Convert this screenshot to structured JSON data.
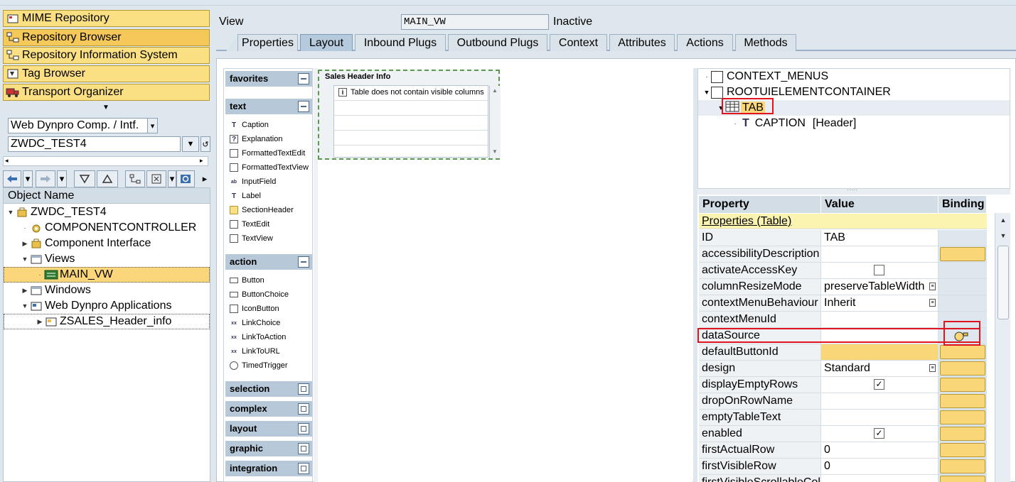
{
  "nav": {
    "buttons": [
      "MIME Repository",
      "Repository Browser",
      "Repository Information System",
      "Tag Browser",
      "Transport Organizer"
    ],
    "object_type": "Web Dynpro Comp. / Intf.",
    "object_name": "ZWDC_TEST4"
  },
  "object_tree": {
    "header": "Object Name",
    "rows": [
      "ZWDC_TEST4",
      "COMPONENTCONTROLLER",
      "Component Interface",
      "Views",
      "MAIN_VW",
      "Windows",
      "Web Dynpro Applications",
      "ZSALES_Header_info"
    ]
  },
  "view": {
    "label": "View",
    "name": "MAIN_VW",
    "status": "Inactive"
  },
  "tabs": [
    "Properties",
    "Layout",
    "Inbound Plugs",
    "Outbound Plugs",
    "Context",
    "Attributes",
    "Actions",
    "Methods"
  ],
  "palette": {
    "favorites": "favorites",
    "text": "text",
    "text_items": [
      "Caption",
      "Explanation",
      "FormattedTextEdit",
      "FormattedTextView",
      "InputField",
      "Label",
      "SectionHeader",
      "TextEdit",
      "TextView"
    ],
    "action": "action",
    "action_items": [
      "Button",
      "ButtonChoice",
      "IconButton",
      "LinkChoice",
      "LinkToAction",
      "LinkToURL",
      "TimedTrigger"
    ],
    "collapsed": [
      "selection",
      "complex",
      "layout",
      "graphic",
      "integration"
    ]
  },
  "table_preview": {
    "title": "Sales Header Info",
    "message": "Table does not contain visible columns"
  },
  "ui_tree": {
    "rows": [
      "CONTEXT_MENUS",
      "ROOTUIELEMENTCONTAINER",
      "TAB",
      "CAPTION",
      "[Header]"
    ]
  },
  "properties": {
    "headers": [
      "Property",
      "Value",
      "Binding"
    ],
    "section": "Properties (Table)",
    "rows": [
      {
        "name": "ID",
        "value": "TAB",
        "kind": "text",
        "bind": false
      },
      {
        "name": "accessibilityDescription",
        "value": "",
        "kind": "text",
        "bind": true
      },
      {
        "name": "activateAccessKey",
        "value": "",
        "kind": "checkbox",
        "checked": false,
        "bind": false
      },
      {
        "name": "columnResizeMode",
        "value": "preserveTableWidth",
        "kind": "dropdown",
        "bind": false
      },
      {
        "name": "contextMenuBehaviour",
        "value": "Inherit",
        "kind": "dropdown",
        "bind": false
      },
      {
        "name": "contextMenuId",
        "value": "",
        "kind": "text",
        "bind": false
      },
      {
        "name": "dataSource",
        "value": "",
        "kind": "text",
        "bind": "icon"
      },
      {
        "name": "defaultButtonId",
        "value": "",
        "kind": "yellow",
        "bind": true
      },
      {
        "name": "design",
        "value": "Standard",
        "kind": "dropdown",
        "bind": true
      },
      {
        "name": "displayEmptyRows",
        "value": "",
        "kind": "checkbox",
        "checked": true,
        "bind": true
      },
      {
        "name": "dropOnRowName",
        "value": "",
        "kind": "text",
        "bind": true
      },
      {
        "name": "emptyTableText",
        "value": "",
        "kind": "text",
        "bind": true
      },
      {
        "name": "enabled",
        "value": "",
        "kind": "checkbox",
        "checked": true,
        "bind": true
      },
      {
        "name": "firstActualRow",
        "value": "0",
        "kind": "text",
        "bind": true
      },
      {
        "name": "firstVisibleRow",
        "value": "0",
        "kind": "text",
        "bind": true
      },
      {
        "name": "firstVisibleScrollableCol",
        "value": "",
        "kind": "text",
        "bind": true
      }
    ]
  }
}
